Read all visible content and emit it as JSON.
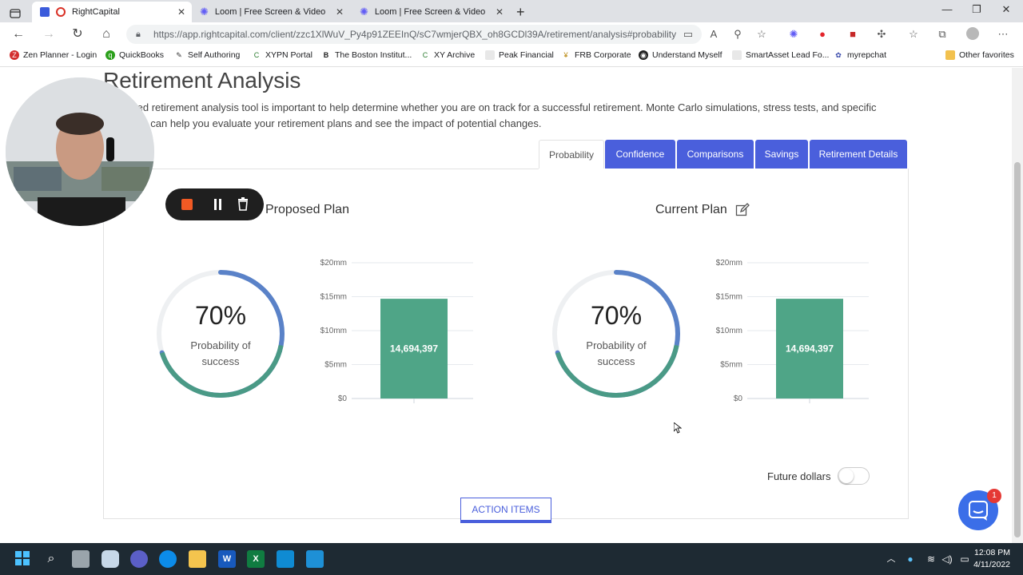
{
  "browser": {
    "tabs": [
      {
        "title": "RightCapital",
        "active": true
      },
      {
        "title": "Loom | Free Screen & Video Rec",
        "active": false
      },
      {
        "title": "Loom | Free Screen & Video Rec",
        "active": false
      }
    ],
    "new_tab_icon": "plus-icon",
    "url": "https://app.rightcapital.com/client/zzc1XlWuV_Py4p91ZEEInQ/sC7wmjerQBX_oh8GCDl39A/retirement/analysis#probability",
    "bookmarks": [
      "Zen Planner - Login",
      "QuickBooks",
      "Self Authoring",
      "XYPN Portal",
      "The Boston Institut...",
      "XY Archive",
      "Peak Financial",
      "FRB Corporate",
      "Understand Myself",
      "SmartAsset Lead Fo...",
      "myrepchat"
    ],
    "other_favorites": "Other favorites"
  },
  "page": {
    "title": "Retirement Analysis",
    "description": "A detailed retirement analysis tool is important to help determine whether you are on track for a successful retirement. Monte Carlo simulations, stress tests, and specific scenarios can help you evaluate your retirement plans and see the impact of potential changes.",
    "tabs": [
      "Probability",
      "Confidence",
      "Comparisons",
      "Savings",
      "Retirement Details"
    ],
    "active_tab": "Probability",
    "accent_color": "#4a5fdc",
    "plans": [
      {
        "title": "Proposed Plan",
        "probability_pct": "70%",
        "probability_fraction": 0.7,
        "label_line1": "Probability of",
        "label_line2": "success"
      },
      {
        "title": "Current Plan",
        "probability_pct": "70%",
        "probability_fraction": 0.7,
        "label_line1": "Probability of",
        "label_line2": "success"
      }
    ],
    "future_dollars_label": "Future dollars",
    "future_dollars_on": false,
    "action_items_label": "ACTION ITEMS",
    "chat_badge_count": "1"
  },
  "chart_data": [
    {
      "type": "bar",
      "categories": [
        ""
      ],
      "values": [
        14694397
      ],
      "data_labels": [
        "14,694,397"
      ],
      "ytick_labels": [
        "$20mm",
        "$15mm",
        "$10mm",
        "$5mm",
        "$0"
      ],
      "ylim": [
        0,
        20000000
      ],
      "bar_color": "#4fa587"
    },
    {
      "type": "bar",
      "categories": [
        ""
      ],
      "values": [
        14694397
      ],
      "data_labels": [
        "14,694,397"
      ],
      "ytick_labels": [
        "$20mm",
        "$15mm",
        "$10mm",
        "$5mm",
        "$0"
      ],
      "ylim": [
        0,
        20000000
      ],
      "bar_color": "#4fa587"
    }
  ],
  "taskbar": {
    "time": "12:08 PM",
    "date": "4/11/2022"
  }
}
